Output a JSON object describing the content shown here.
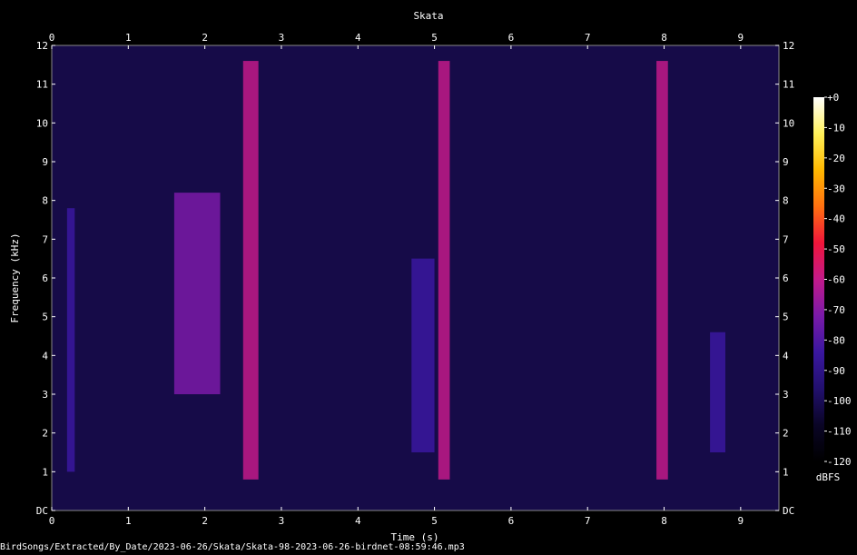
{
  "chart_data": {
    "type": "heatmap",
    "title": "Skata",
    "xlabel": "Time (s)",
    "ylabel": "Frequency (kHz)",
    "xlim": [
      0,
      9.5
    ],
    "ylim": [
      0,
      12
    ],
    "x_ticks": [
      "0",
      "1",
      "2",
      "3",
      "4",
      "5",
      "6",
      "7",
      "8",
      "9"
    ],
    "y_ticks": [
      "DC",
      "1",
      "2",
      "3",
      "4",
      "5",
      "6",
      "7",
      "8",
      "9",
      "10",
      "11",
      "12"
    ],
    "colorbar": {
      "label": "dBFS",
      "range": [
        -120,
        0
      ],
      "ticks": [
        "+0",
        "-10",
        "-20",
        "-30",
        "-40",
        "-50",
        "-60",
        "-70",
        "-80",
        "-90",
        "-100",
        "-110",
        "-120"
      ]
    },
    "colormap": [
      "#000000",
      "#0a0526",
      "#22106e",
      "#3a17a0",
      "#7a1aa8",
      "#c21a8a",
      "#f0153a",
      "#ff7010",
      "#ffb800",
      "#fff15a",
      "#ffffff"
    ],
    "signals": [
      {
        "t_start": 0.2,
        "t_end": 0.3,
        "f_low": 1.0,
        "f_high": 7.8,
        "level_dbfs": -85
      },
      {
        "t_start": 1.6,
        "t_end": 2.2,
        "f_low": 3.0,
        "f_high": 8.2,
        "level_dbfs": -75
      },
      {
        "t_start": 2.5,
        "t_end": 2.7,
        "f_low": 0.8,
        "f_high": 11.6,
        "level_dbfs": -60
      },
      {
        "t_start": 4.7,
        "t_end": 5.0,
        "f_low": 1.5,
        "f_high": 6.5,
        "level_dbfs": -85
      },
      {
        "t_start": 5.05,
        "t_end": 5.2,
        "f_low": 0.8,
        "f_high": 11.6,
        "level_dbfs": -60
      },
      {
        "t_start": 7.9,
        "t_end": 8.05,
        "f_low": 0.8,
        "f_high": 11.6,
        "level_dbfs": -60
      },
      {
        "t_start": 8.6,
        "t_end": 8.8,
        "f_low": 1.5,
        "f_high": 4.6,
        "level_dbfs": -85
      }
    ]
  },
  "footer": "BirdSongs/Extracted/By_Date/2023-06-26/Skata/Skata-98-2023-06-26-birdnet-08:59:46.mp3"
}
